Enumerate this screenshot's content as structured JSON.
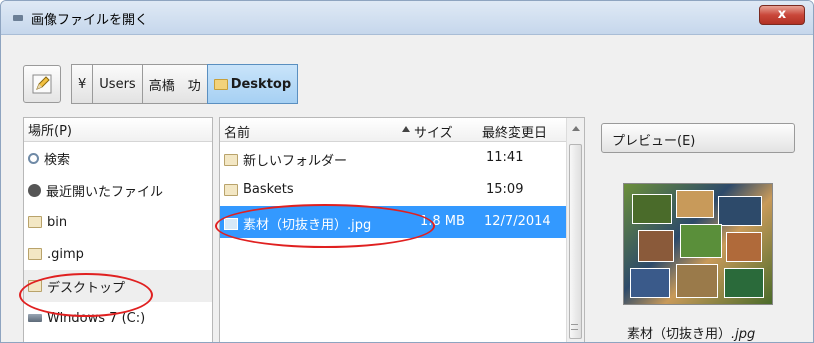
{
  "window": {
    "title": "画像ファイルを開く",
    "close_label": "x"
  },
  "toolbar": {
    "edit_icon": "pencil-edit-icon",
    "breadcrumbs": [
      "¥",
      "Users",
      "高橋　功",
      "Desktop"
    ]
  },
  "places": {
    "header": "場所(P)",
    "items": [
      {
        "label": "検索",
        "icon": "search-icon"
      },
      {
        "label": "最近開いたファイル",
        "icon": "recent-icon"
      },
      {
        "label": "bin",
        "icon": "folder-icon"
      },
      {
        "label": ".gimp",
        "icon": "folder-icon"
      },
      {
        "label": "デスクトップ",
        "icon": "folder-icon"
      },
      {
        "label": "Windows 7 (C:)",
        "icon": "drive-icon"
      }
    ],
    "selected": "デスクトップ"
  },
  "files": {
    "headers": {
      "name": "名前",
      "size": "サイズ",
      "modified": "最終変更日"
    },
    "sort": "name ascending",
    "rows": [
      {
        "name": "新しいフォルダー",
        "size": "",
        "modified": "11:41",
        "icon": "folder-icon"
      },
      {
        "name": "Baskets",
        "size": "",
        "modified": "15:09",
        "icon": "folder-icon"
      },
      {
        "name": "素材（切抜き用）.jpg",
        "size": "1.8 MB",
        "modified": "12/7/2014",
        "icon": "image-file-icon"
      }
    ],
    "selected": "素材（切抜き用）.jpg"
  },
  "preview": {
    "button_label": "プレビュー(E)",
    "caption_name": "素材（切抜き用）",
    "caption_ext": ".jpg"
  },
  "colors": {
    "selection": "#3399ff",
    "annotation": "#e02020",
    "close_button": "#c9473a"
  }
}
